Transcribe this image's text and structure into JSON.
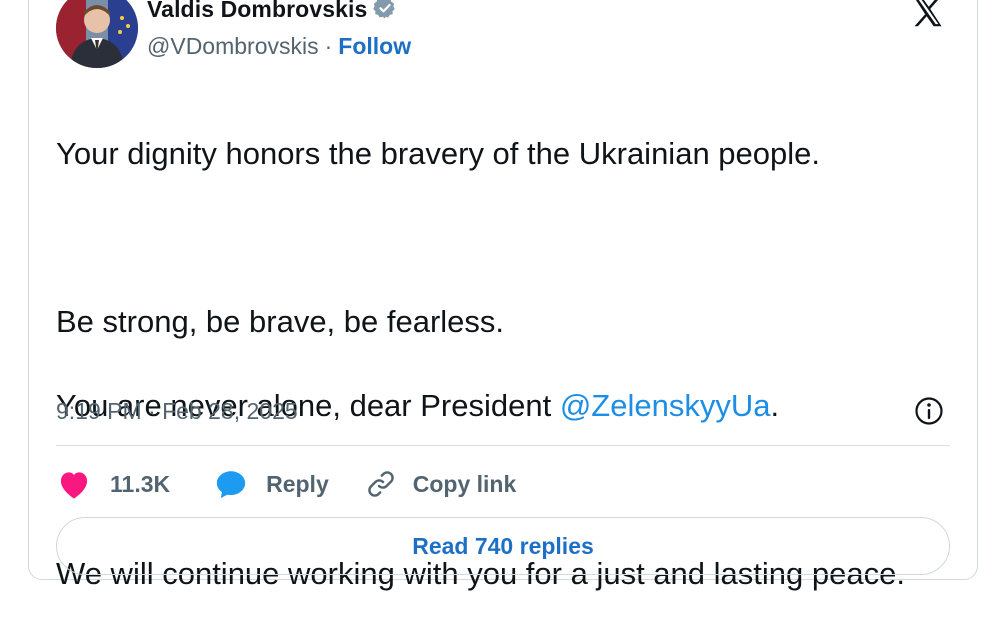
{
  "author": {
    "display_name": "Valdis Dombrovskis",
    "handle": "@VDombrovskis",
    "separator": "·",
    "follow_label": "Follow",
    "verified_icon": "verified-badge-icon"
  },
  "tweet": {
    "line1": "Your dignity honors the bravery of the Ukrainian people.",
    "line2": "Be strong, be brave, be fearless.",
    "line3_prefix": "You are never alone, dear President ",
    "mention": "@ZelenskyyUa",
    "line3_suffix": ".",
    "line4": "We will continue working with you for a just and lasting peace."
  },
  "meta": {
    "timestamp": "9:19 PM · Feb 28, 2025"
  },
  "actions": {
    "likes": "11.3K",
    "reply_label": "Reply",
    "copy_label": "Copy link"
  },
  "replies": {
    "label": "Read 740 replies"
  },
  "colors": {
    "like": "#f91880",
    "reply_icon": "#1d9bf0",
    "link": "#1d70c6",
    "mention": "#1d8ee6",
    "muted": "#536471"
  }
}
